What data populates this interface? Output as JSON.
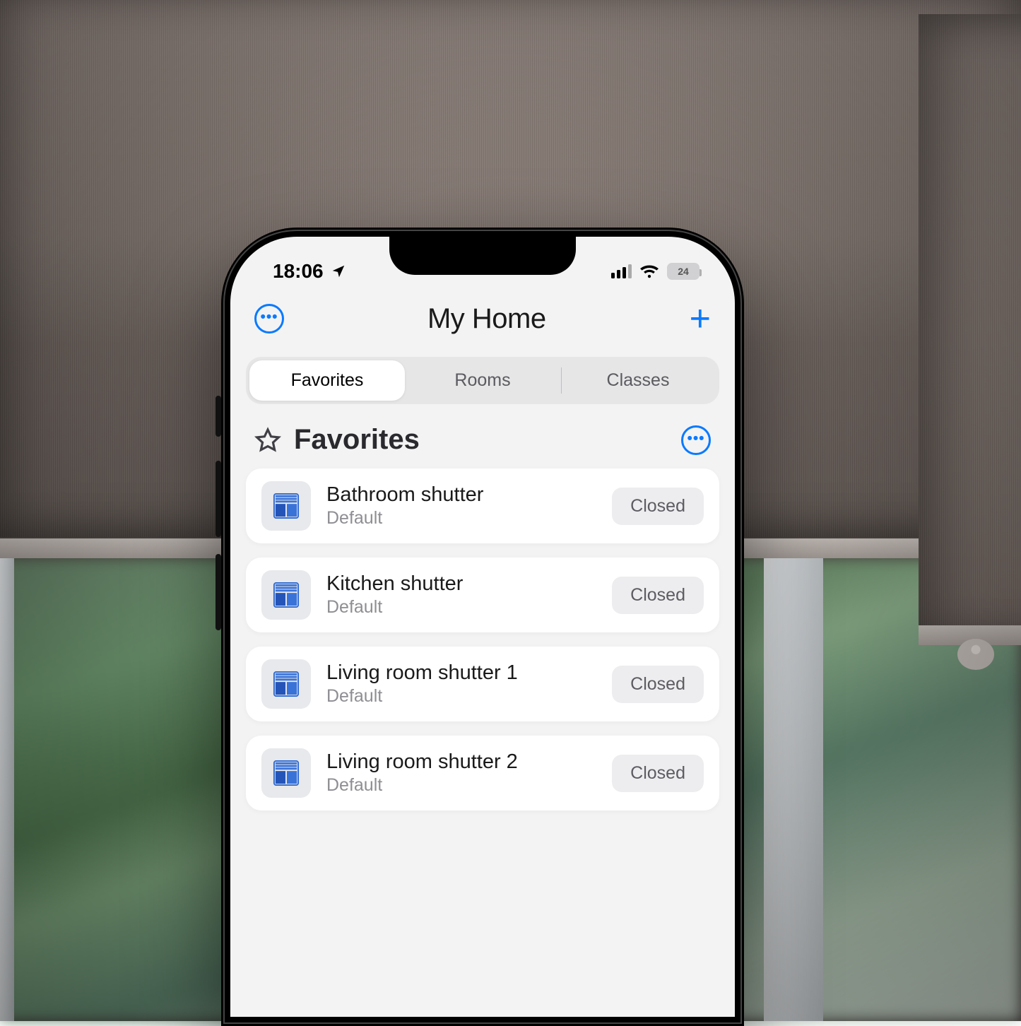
{
  "statusbar": {
    "time": "18:06",
    "battery": "24"
  },
  "header": {
    "title": "My Home"
  },
  "tabs": [
    {
      "label": "Favorites",
      "active": true
    },
    {
      "label": "Rooms",
      "active": false
    },
    {
      "label": "Classes",
      "active": false
    }
  ],
  "section": {
    "title": "Favorites"
  },
  "devices": [
    {
      "name": "Bathroom shutter",
      "room": "Default",
      "state": "Closed"
    },
    {
      "name": "Kitchen shutter",
      "room": "Default",
      "state": "Closed"
    },
    {
      "name": "Living room shutter 1",
      "room": "Default",
      "state": "Closed"
    },
    {
      "name": "Living room shutter 2",
      "room": "Default",
      "state": "Closed"
    }
  ]
}
